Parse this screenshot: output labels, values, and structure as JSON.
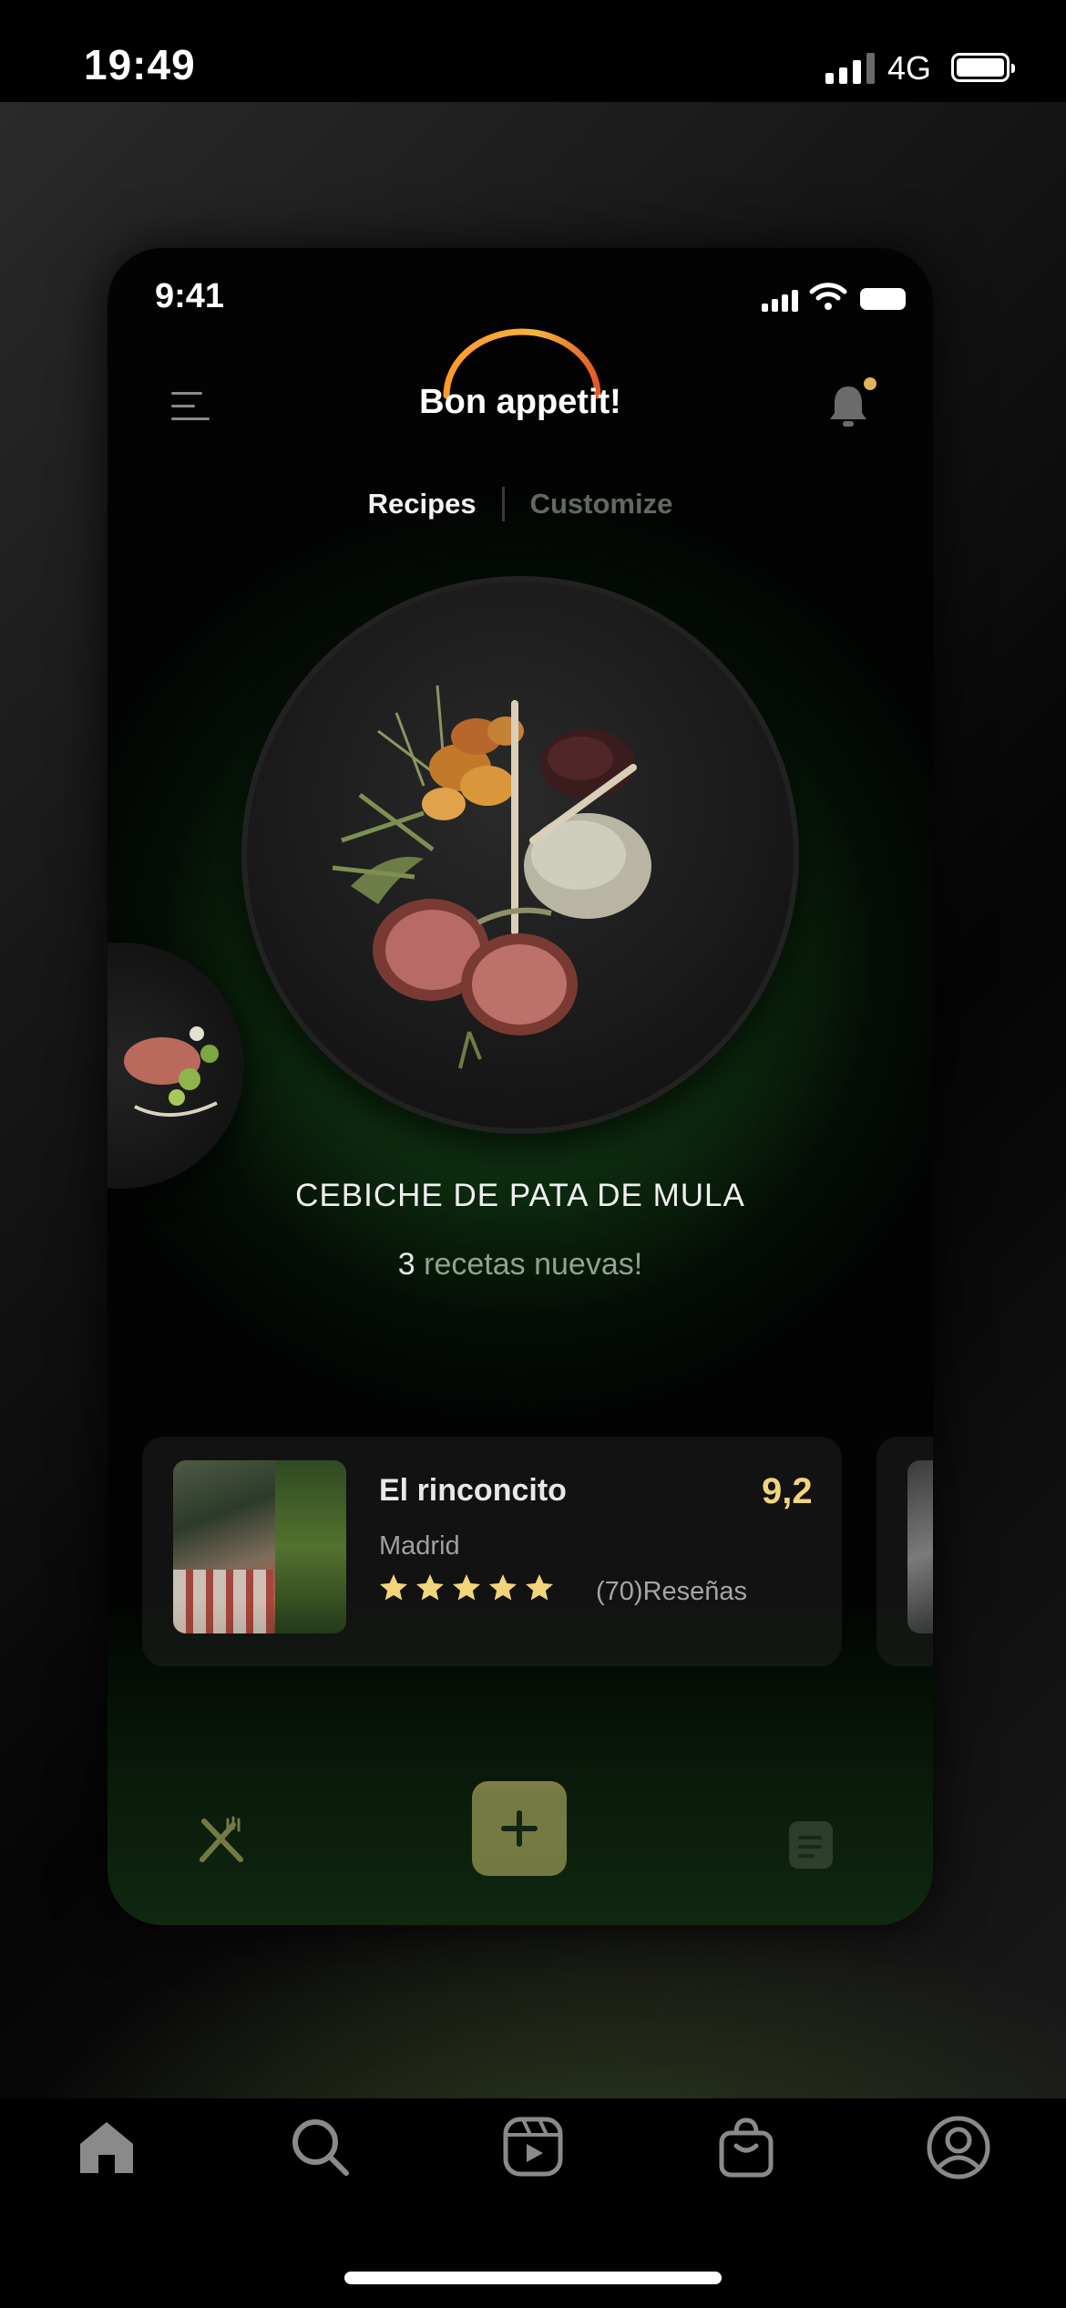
{
  "outer_status": {
    "time": "19:49",
    "network": "4G"
  },
  "inner_status": {
    "time": "9:41"
  },
  "app": {
    "title": "Bon appetit!"
  },
  "tabs": [
    {
      "label": "Recipes",
      "active": true
    },
    {
      "label": "Customize",
      "active": false
    }
  ],
  "featured": {
    "title": "CEBICHE DE PATA DE MULA",
    "count": "3",
    "subtitle": " recetas nuevas!"
  },
  "restaurant": {
    "name": "El rinconcito",
    "city": "Madrid",
    "score": "9,2",
    "stars": 5,
    "reviews": "(70)Reseñas"
  },
  "bottom_nav": {
    "left": "utensils-icon",
    "center": "plus-icon",
    "right": "document-icon"
  },
  "ig_nav": [
    "home-icon",
    "search-icon",
    "reels-icon",
    "shop-icon",
    "profile-icon"
  ],
  "colors": {
    "accent": "#f0d37c",
    "star": "#f2d47a",
    "background_green": "#1f5b22",
    "notification_dot": "#e2b35c"
  }
}
